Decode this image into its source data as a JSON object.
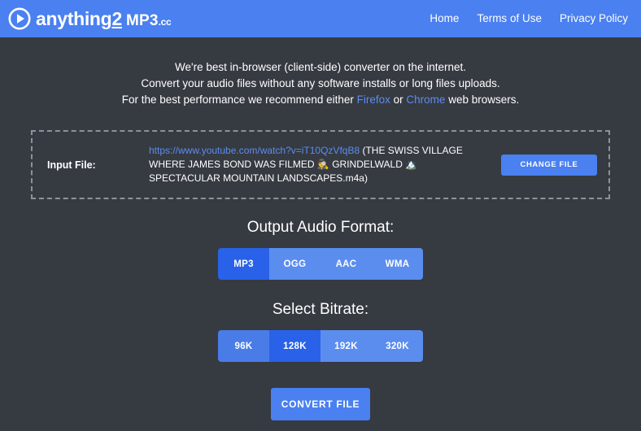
{
  "colors": {
    "header_blue": "#4a80f0",
    "page_background": "#363a41",
    "accent_blue": "#5b8def",
    "active_blue": "#2962e8",
    "dashed_border": "#8d9199",
    "text": "#ffffff"
  },
  "header": {
    "logo": {
      "icon": "play-circle-icon",
      "word": "anything",
      "two": "2",
      "mp3": "MP3",
      "tld": ".cc"
    },
    "nav": [
      {
        "label": "Home"
      },
      {
        "label": "Terms of Use"
      },
      {
        "label": "Privacy Policy"
      }
    ]
  },
  "intro": {
    "line1": "We're best in-browser (client-side) converter on the internet.",
    "line2": "Convert your audio files without any software installs or long files uploads.",
    "line3_prefix": "For the best performance we recommend either ",
    "link_firefox": "Firefox",
    "line3_mid": " or ",
    "link_chrome": "Chrome",
    "line3_suffix": " web browsers."
  },
  "input_file": {
    "label": "Input File:",
    "url": "https://www.youtube.com/watch?v=iT10QzVfqB8",
    "name_rest": " (THE SWISS VILLAGE WHERE JAMES BOND WAS FILMED ",
    "emoji1": "🕵️",
    "name_mid": " GRINDELWALD ",
    "emoji2": "🏔️",
    "name_end": " SPECTACULAR MOUNTAIN LANDSCAPES.m4a)",
    "change_button": "CHANGE FILE"
  },
  "output_format": {
    "title": "Output Audio Format:",
    "options": [
      {
        "label": "MP3",
        "selected": true
      },
      {
        "label": "OGG",
        "selected": false
      },
      {
        "label": "AAC",
        "selected": false
      },
      {
        "label": "WMA",
        "selected": false
      }
    ],
    "selected_value": "MP3"
  },
  "bitrate": {
    "title": "Select Bitrate:",
    "options": [
      {
        "label": "96K",
        "selected": false
      },
      {
        "label": "128K",
        "selected": true
      },
      {
        "label": "192K",
        "selected": false
      },
      {
        "label": "320K",
        "selected": false
      }
    ],
    "selected_value": "128K"
  },
  "convert": {
    "label": "CONVERT FILE"
  }
}
